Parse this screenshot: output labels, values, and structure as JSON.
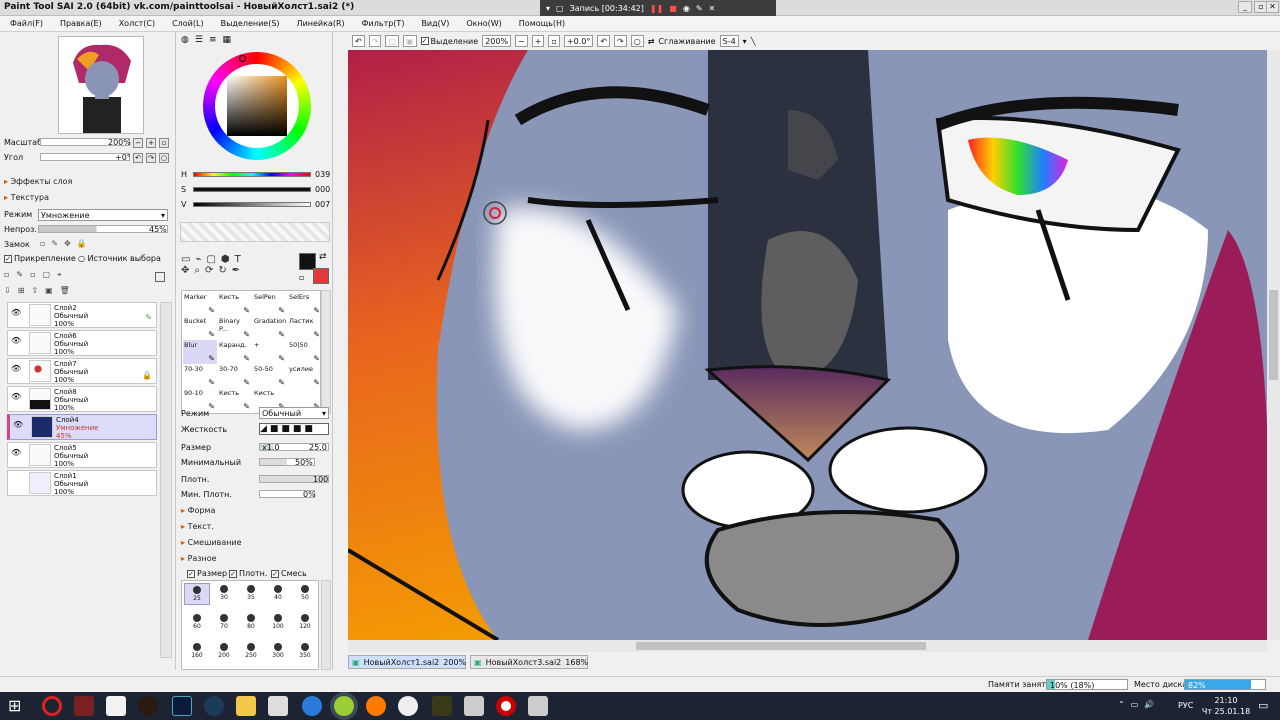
{
  "titlebar": {
    "title": "Paint Tool SAI 2.0 (64bit) vk.com/painttoolsai - НовыйХолст1.sai2 (*)"
  },
  "recorder": {
    "label": "Запись [00:34:42]"
  },
  "menu": [
    "Файл(F)",
    "Правка(E)",
    "Холст(C)",
    "Слой(L)",
    "Выделение(S)",
    "Линейка(R)",
    "Фильтр(T)",
    "Вид(V)",
    "Окно(W)",
    "Помощь(H)"
  ],
  "navigator": {
    "zoom_label": "Масштаб",
    "zoom_value": "200%",
    "angle_label": "Угол",
    "angle_value": "+0°"
  },
  "sections": {
    "effects": "Эффекты слоя",
    "texture": "Текстура"
  },
  "layer_props": {
    "mode_label": "Режим",
    "mode_value": "Умножение",
    "opacity_label": "Непроз.",
    "opacity_value": "45%",
    "lock_label": "Замок",
    "clip_label": "Прикрепление",
    "source_label": "Источник выбора"
  },
  "layers": [
    {
      "name": "Слой2",
      "mode": "Обычный",
      "opacity": "100%"
    },
    {
      "name": "Слой6",
      "mode": "Обычный",
      "opacity": "100%"
    },
    {
      "name": "Слой7",
      "mode": "Обычный",
      "opacity": "100%"
    },
    {
      "name": "Слой8",
      "mode": "Обычный",
      "opacity": "100%"
    },
    {
      "name": "Слой4",
      "mode": "Умножение",
      "opacity": "45%"
    },
    {
      "name": "Слой5",
      "mode": "Обычный",
      "opacity": "100%"
    },
    {
      "name": "Слой1",
      "mode": "Обычный",
      "opacity": "100%"
    }
  ],
  "color": {
    "h_label": "H",
    "h_value": "039",
    "s_label": "S",
    "s_value": "000",
    "v_label": "V",
    "v_value": "007",
    "fg": "#111111",
    "bg": "#e03a3a"
  },
  "tools": [
    {
      "label": "Marker"
    },
    {
      "label": "Кисть"
    },
    {
      "label": "SelPen"
    },
    {
      "label": "SelErs"
    },
    {
      "label": "Bucket"
    },
    {
      "label": "Binary P..."
    },
    {
      "label": "Gradation"
    },
    {
      "label": "Ластик"
    },
    {
      "label": "Blur"
    },
    {
      "label": "Каранд."
    },
    {
      "label": "+"
    },
    {
      "label": "50|50"
    },
    {
      "label": "70-30"
    },
    {
      "label": "30-70"
    },
    {
      "label": "50-50"
    },
    {
      "label": "усилие"
    },
    {
      "label": "90-10"
    },
    {
      "label": "Кисть"
    },
    {
      "label": "Кисть"
    },
    {
      "label": ""
    }
  ],
  "brush": {
    "mode_label": "Режим",
    "mode_value": "Обычный",
    "hardness_label": "Жесткость",
    "size_label": "Размер",
    "size_mult": "x1.0",
    "size_value": "25.0",
    "min_label": "Минимальный",
    "min_value": "50%",
    "density_label": "Плотн.",
    "density_value": "100",
    "mindens_label": "Мин. Плотн.",
    "mindens_value": "0%"
  },
  "brush_sections": [
    "Форма",
    "Текст.",
    "Смешивание",
    "Разное"
  ],
  "brush_checks": [
    "Размер",
    "Плотн.",
    "Смесь"
  ],
  "brush_sizes": [
    "25",
    "30",
    "35",
    "40",
    "50",
    "60",
    "70",
    "80",
    "100",
    "120",
    "160",
    "200",
    "250",
    "300",
    "350"
  ],
  "toolbar": {
    "selection_label": "Выделение",
    "zoom": "200%",
    "angle": "+0.0°",
    "smoothing_label": "Сглаживание",
    "smoothing_value": "S-4"
  },
  "documents": [
    {
      "name": "НовыйХолст1.sai2",
      "zoom": "200%"
    },
    {
      "name": "НовыйХолст3.sai2",
      "zoom": "168%"
    }
  ],
  "status": {
    "memory_label": "Памяти занято",
    "memory_value": "10% (18%)",
    "disk_label": "Место диска",
    "disk_value": "82%"
  },
  "taskbar": {
    "lang": "РУС",
    "time": "21:10",
    "date": "Чт 25.01.18"
  }
}
